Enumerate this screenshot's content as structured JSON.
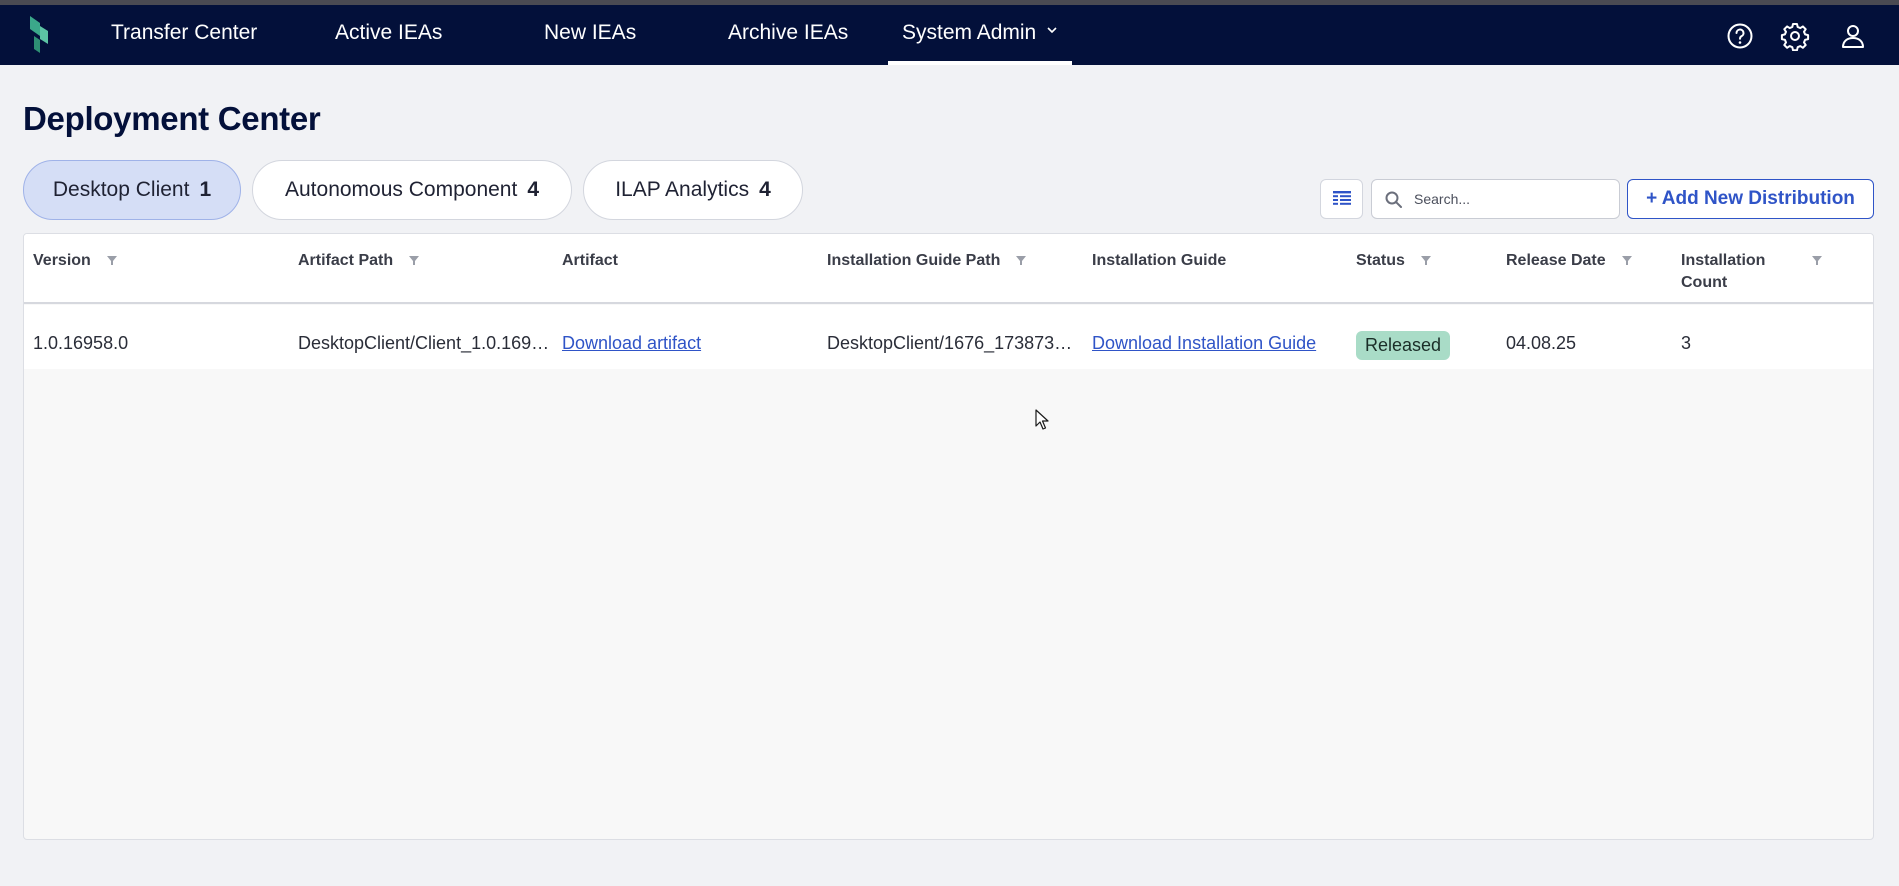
{
  "nav": {
    "items": [
      {
        "label": "Transfer Center"
      },
      {
        "label": "Active IEAs"
      },
      {
        "label": "New IEAs"
      },
      {
        "label": "Archive IEAs"
      },
      {
        "label": "System Admin"
      }
    ],
    "icons": [
      "help-icon",
      "settings-gear-icon",
      "user-account-icon"
    ]
  },
  "page": {
    "title": "Deployment Center"
  },
  "tabs": [
    {
      "label": "Desktop Client",
      "count": "1"
    },
    {
      "label": "Autonomous Component",
      "count": "4"
    },
    {
      "label": "ILAP Analytics",
      "count": "4"
    }
  ],
  "toolbar": {
    "search_placeholder": "Search...",
    "add_label": "+ Add New Distribution"
  },
  "table": {
    "columns": [
      {
        "label": "Version"
      },
      {
        "label": "Artifact Path"
      },
      {
        "label": "Artifact"
      },
      {
        "label": "Installation Guide Path"
      },
      {
        "label": "Installation Guide"
      },
      {
        "label": "Status"
      },
      {
        "label": "Release Date"
      },
      {
        "label": "Installation Count"
      }
    ],
    "rows": [
      {
        "version": "1.0.16958.0",
        "artifact_path": "DesktopClient/Client_1.0.169…",
        "artifact": "Download artifact",
        "guide_path": "DesktopClient/1676_173873…",
        "guide": "Download Installation Guide",
        "status": "Released",
        "release_date": "04.08.25",
        "install_count": "3"
      }
    ]
  },
  "colors": {
    "navbar": "#03103a",
    "accent": "#2f54c7",
    "active_tab": "#d5def6",
    "status_released": "#a9dcc7"
  }
}
